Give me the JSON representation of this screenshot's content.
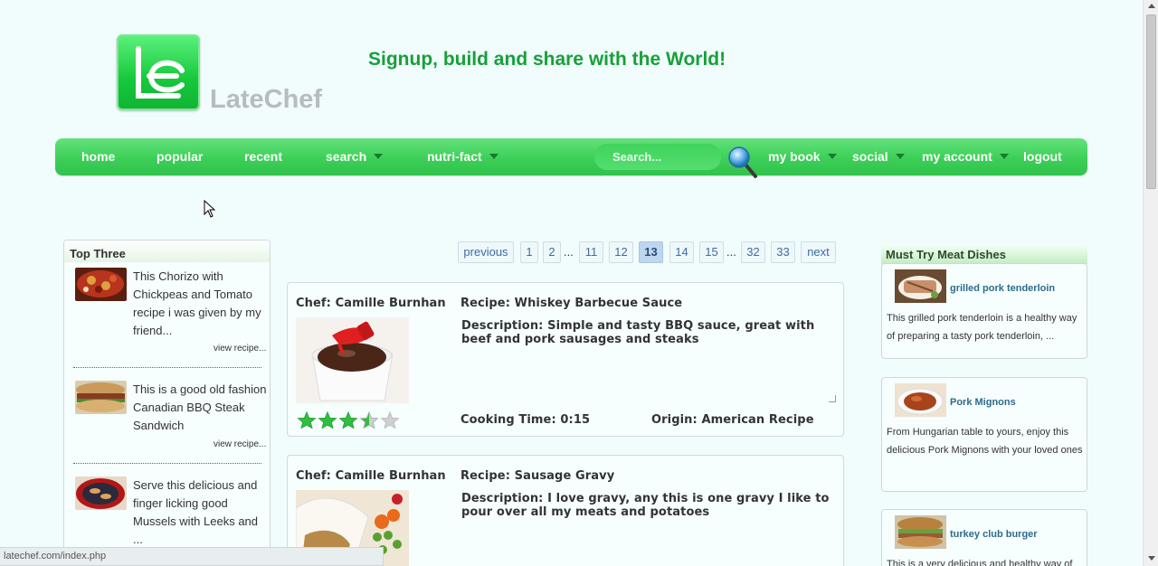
{
  "header": {
    "logo_text": "LateChef",
    "tagline": "Signup, build and share with the World!"
  },
  "nav": {
    "home": "home",
    "popular": "popular",
    "recent": "recent",
    "search": "search",
    "nutri_fact": "nutri-fact",
    "search_placeholder": "Search...",
    "my_book": "my book",
    "social": "social",
    "my_account": "my account",
    "logout": "logout"
  },
  "top_three": {
    "title": "Top Three",
    "items": [
      {
        "text": "This Chorizo with Chickpeas and Tomato recipe i was given by my friend...",
        "link": "view recipe..."
      },
      {
        "text": "This is a good old fashion Canadian BBQ Steak Sandwich",
        "link": "view recipe..."
      },
      {
        "text": "Serve this delicious and finger licking good Mussels with Leeks and ...",
        "link": ""
      }
    ]
  },
  "pagination": {
    "previous": "previous",
    "pages": [
      "1",
      "2",
      "11",
      "12",
      "13",
      "14",
      "15",
      "32",
      "33"
    ],
    "ellipsis": "...",
    "next": "next",
    "current": "13"
  },
  "recipes": [
    {
      "chef": "Chef: Camille Burnhan",
      "recipe": "Recipe: Whiskey Barbecue Sauce",
      "description": "Description: Simple and tasty BBQ sauce, great with beef and pork sausages and steaks",
      "cooking_time": "Cooking Time: 0:15",
      "origin": "Origin: American Recipe",
      "rating": 3.5,
      "rating_max": 5
    },
    {
      "chef": "Chef: Camille Burnhan",
      "recipe": "Recipe: Sausage Gravy",
      "description": "Description: I love gravy, any this is one gravy I like to pour over all my meats and potatoes"
    }
  ],
  "meat_dishes": {
    "title": "Must Try Meat Dishes",
    "items": [
      {
        "name": "grilled pork tenderloin",
        "text": "This grilled pork tenderloin is a healthy way of preparing a tasty pork tenderloin, ..."
      },
      {
        "name": "Pork Mignons",
        "text": "From Hungarian table to yours, enjoy this delicious Pork Mignons with your loved ones"
      },
      {
        "name": "turkey club burger",
        "text": "This is a very delicious and healthy way of"
      }
    ]
  },
  "status": {
    "url": "latechef.com/index.php"
  },
  "colors": {
    "nav_green": "#3ccf57",
    "tagline_green": "#17a03a",
    "page_bg": "#f1fcfc",
    "star_green": "#2fbf3f"
  }
}
